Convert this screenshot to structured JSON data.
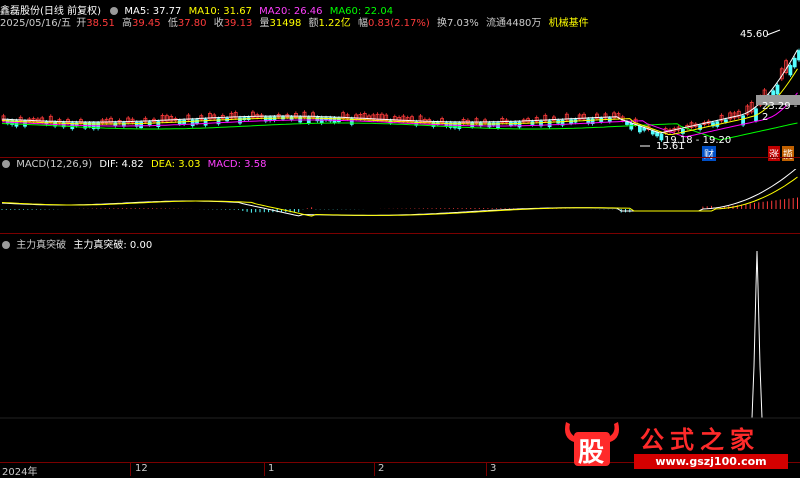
{
  "header1": {
    "title": "鑫磊股份(日线 前复权)",
    "ma5": "MA5: 37.77",
    "ma10": "MA10: 31.67",
    "ma20": "MA20: 26.46",
    "ma60": "MA60: 22.04"
  },
  "header2": {
    "date": "2025/05/16/五",
    "open_label": "开",
    "open": "38.51",
    "high_label": "高",
    "high": "39.45",
    "low_label": "低",
    "low": "37.80",
    "close_label": "收",
    "close": "39.13",
    "vol_label": "量",
    "vol": "31498",
    "amt_label": "额",
    "amt": "1.22亿",
    "chg_label": "幅",
    "chg": "0.83(2.17%)",
    "turnover": "换7.03%",
    "float": "流通4480万",
    "sector": "机械基件"
  },
  "annotations": {
    "peak": "45.60",
    "low": "15.61",
    "range": "19.18 - 19.20",
    "right_price": "23.29 - 2",
    "cai": "财",
    "zhang": "涨",
    "qu": "揽"
  },
  "macd": {
    "title": "MACD(12,26,9)",
    "dif": "DIF: 4.82",
    "dea": "DEA: 3.03",
    "macd": "MACD: 3.58"
  },
  "zlzt": {
    "title": "主力真突破",
    "value": "主力真突破: 0.00"
  },
  "axis": {
    "labels": [
      "2024年",
      "12",
      "1",
      "2",
      "3"
    ]
  },
  "watermark": {
    "logo": "股",
    "site_name": "公式之家",
    "url": "www.gszj100.com"
  },
  "colors": {
    "background": "#000000",
    "up": "#ff3b3b",
    "down": "#54ffff",
    "ma5": "#ffffff",
    "ma10": "#ffff00",
    "ma20": "#ff00ff",
    "ma60": "#00ff00",
    "separator": "#7a0000"
  }
}
